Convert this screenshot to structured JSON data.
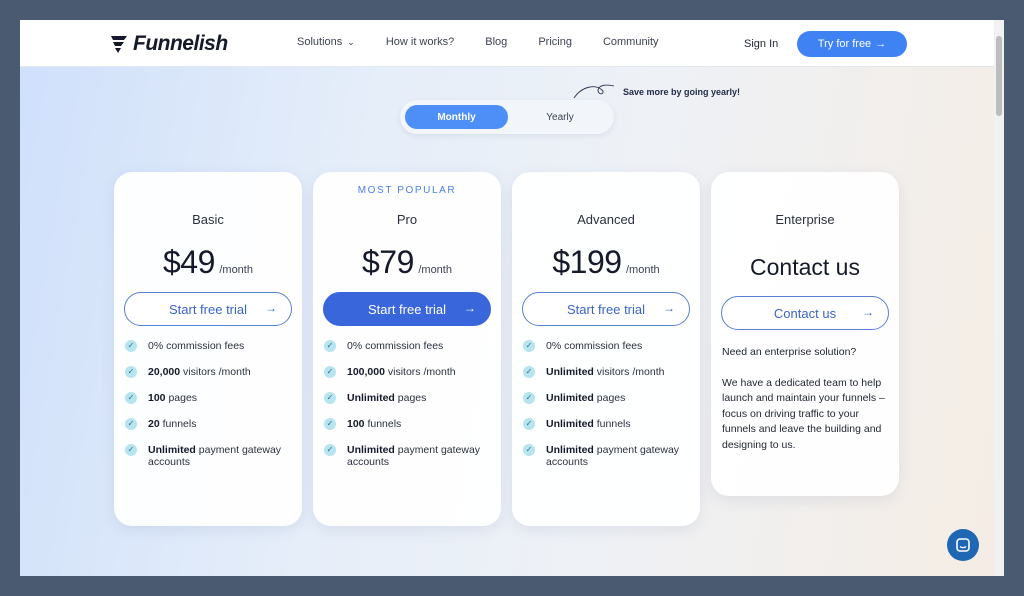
{
  "brand": {
    "name": "Funnelish"
  },
  "nav": {
    "links": [
      {
        "label": "Solutions",
        "has_dropdown": true
      },
      {
        "label": "How it works?"
      },
      {
        "label": "Blog"
      },
      {
        "label": "Pricing"
      },
      {
        "label": "Community"
      }
    ],
    "signin": "Sign In",
    "cta": "Try for free"
  },
  "billing": {
    "options": [
      "Monthly",
      "Yearly"
    ],
    "selected": "Monthly",
    "note": "Save more by going yearly!"
  },
  "plans": [
    {
      "name": "Basic",
      "price": "$49",
      "period": "/month",
      "button": "Start free trial",
      "features": [
        {
          "bold": "",
          "text": "0% commission fees"
        },
        {
          "bold": "20,000",
          "text": " visitors /month"
        },
        {
          "bold": "100",
          "text": " pages"
        },
        {
          "bold": "20",
          "text": " funnels"
        },
        {
          "bold": "Unlimited",
          "text": " payment gateway accounts"
        }
      ]
    },
    {
      "name": "Pro",
      "badge": "MOST POPULAR",
      "price": "$79",
      "period": "/month",
      "button": "Start free trial",
      "features": [
        {
          "bold": "",
          "text": "0% commission fees"
        },
        {
          "bold": "100,000",
          "text": " visitors /month"
        },
        {
          "bold": "Unlimited",
          "text": " pages"
        },
        {
          "bold": "100",
          "text": " funnels"
        },
        {
          "bold": "Unlimited",
          "text": " payment gateway accounts"
        }
      ]
    },
    {
      "name": "Advanced",
      "price": "$199",
      "period": "/month",
      "button": "Start free trial",
      "features": [
        {
          "bold": "",
          "text": "0% commission fees"
        },
        {
          "bold": "Unlimited",
          "text": " visitors /month"
        },
        {
          "bold": "Unlimited",
          "text": " pages"
        },
        {
          "bold": "Unlimited",
          "text": " funnels"
        },
        {
          "bold": "Unlimited",
          "text": " payment gateway accounts"
        }
      ]
    },
    {
      "name": "Enterprise",
      "headline": "Contact us",
      "button": "Contact us",
      "description": [
        "Need an enterprise solution?",
        "We have a dedicated team to help launch and maintain your funnels – focus on driving traffic to your funnels and leave the building and designing to us."
      ]
    }
  ],
  "icons": {
    "check": "check-icon",
    "arrow": "arrow-right-icon",
    "chat": "chat-icon"
  },
  "colors": {
    "accent": "#3f82f4",
    "primary_button": "#3a66dc",
    "check_bg": "#b6e4ef"
  }
}
